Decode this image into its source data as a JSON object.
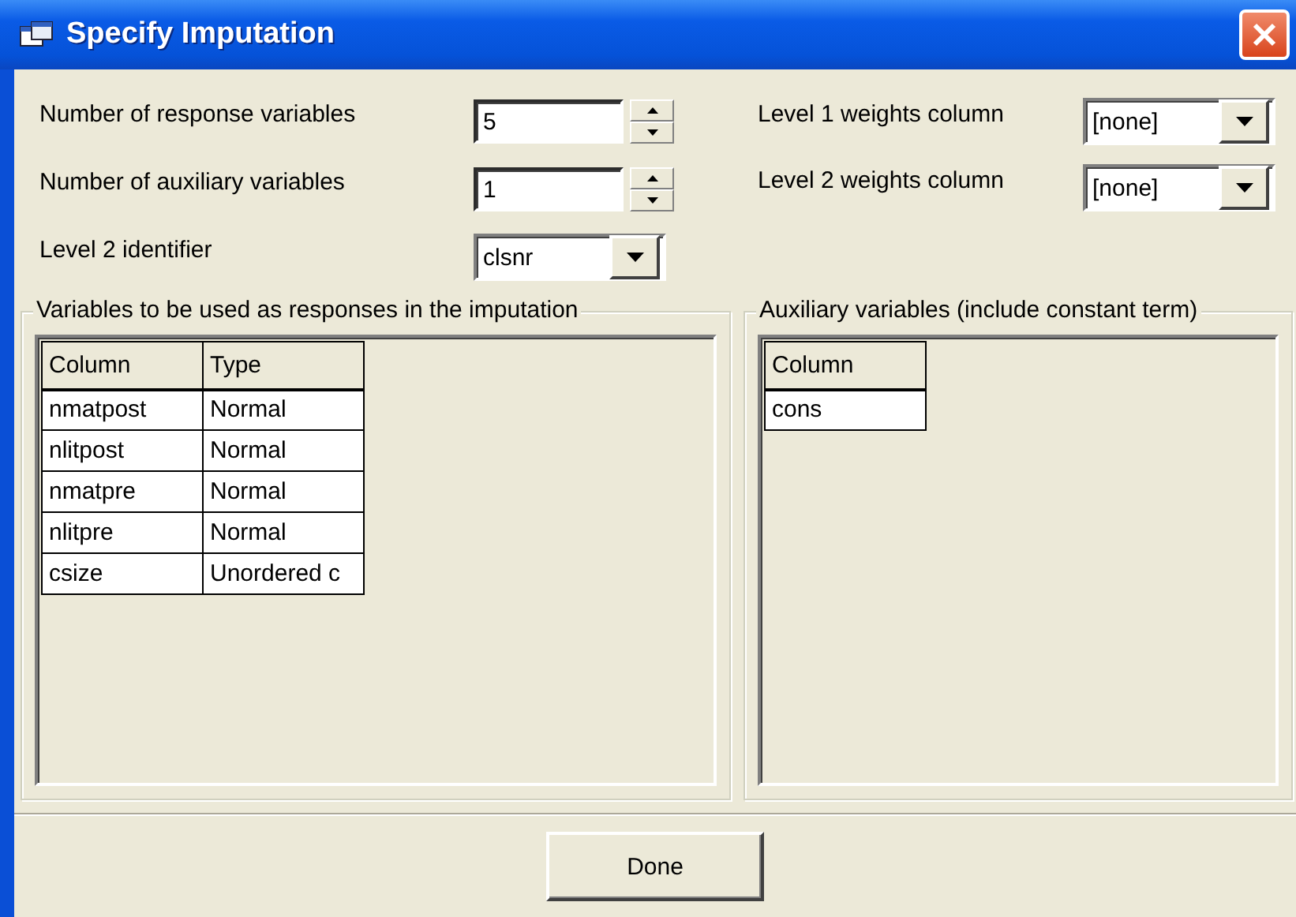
{
  "window": {
    "title": "Specify Imputation"
  },
  "left_fields": [
    {
      "kind": "spin",
      "label": "Number of response variables",
      "value": "5"
    },
    {
      "kind": "spin",
      "label": "Number of auxiliary variables",
      "value": "1"
    },
    {
      "kind": "combo",
      "label": "Level 2 identifier",
      "value": "clsnr"
    }
  ],
  "right_fields": [
    {
      "kind": "combo",
      "label": "Level 1 weights column",
      "value": "[none]"
    },
    {
      "kind": "combo",
      "label": "Level 2 weights column",
      "value": "[none]"
    }
  ],
  "groups": [
    {
      "title": "Variables to be used as responses in the imputation",
      "columns": [
        "Column",
        "Type"
      ],
      "rows": [
        [
          "nmatpost",
          "Normal"
        ],
        [
          "nlitpost",
          "Normal"
        ],
        [
          "nmatpre",
          "Normal"
        ],
        [
          "nlitpre",
          "Normal"
        ],
        [
          "csize",
          "Unordered c"
        ]
      ]
    },
    {
      "title": "Auxiliary variables (include constant term)",
      "columns": [
        "Column"
      ],
      "rows": [
        [
          "cons"
        ]
      ]
    }
  ],
  "buttons": [
    "Done"
  ]
}
